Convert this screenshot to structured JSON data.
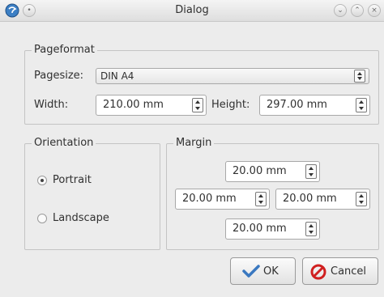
{
  "window": {
    "title": "Dialog"
  },
  "pageformat": {
    "group_title": "Pageformat",
    "pagesize_label": "Pagesize:",
    "pagesize_value": "DIN A4",
    "width_label": "Width:",
    "width_value": "210.00 mm",
    "height_label": "Height:",
    "height_value": "297.00 mm"
  },
  "orientation": {
    "group_title": "Orientation",
    "options": [
      {
        "label": "Portrait",
        "selected": true
      },
      {
        "label": "Landscape",
        "selected": false
      }
    ]
  },
  "margin": {
    "group_title": "Margin",
    "top": "20.00 mm",
    "left": "20.00 mm",
    "right": "20.00 mm",
    "bottom": "20.00 mm"
  },
  "buttons": {
    "ok_label": "OK",
    "cancel_label": "Cancel"
  },
  "colors": {
    "accent": "#4a90d9",
    "cancel_red": "#d02020",
    "check_blue": "#3a78c0"
  }
}
